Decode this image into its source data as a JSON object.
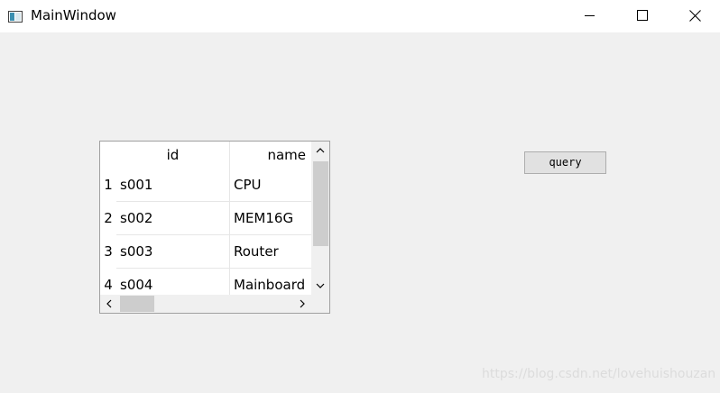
{
  "window": {
    "title": "MainWindow",
    "icon": "window-icon",
    "controls": [
      "minimize-icon",
      "maximize-icon",
      "close-icon"
    ]
  },
  "table": {
    "columns": [
      "id",
      "name"
    ],
    "rows": [
      {
        "num": "1",
        "id": "s001",
        "name": "CPU"
      },
      {
        "num": "2",
        "id": "s002",
        "name": "MEM16G"
      },
      {
        "num": "3",
        "id": "s003",
        "name": "Router"
      },
      {
        "num": "4",
        "id": "s004",
        "name": "Mainboard"
      }
    ]
  },
  "buttons": {
    "query_label": "query"
  },
  "watermark": "https://blog.csdn.net/lovehuishouzan"
}
